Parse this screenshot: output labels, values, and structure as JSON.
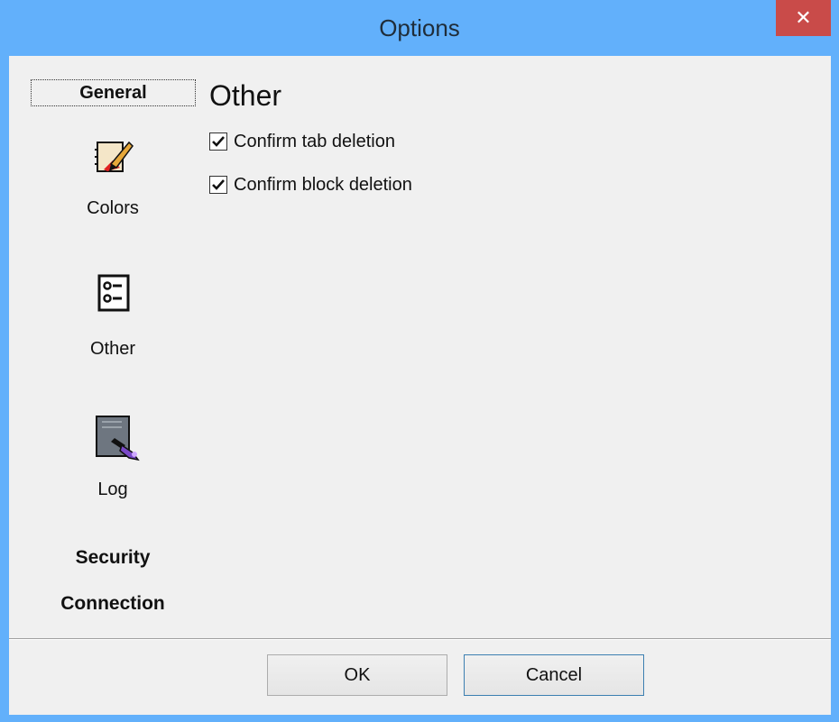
{
  "window": {
    "title": "Options",
    "close_label": "✕"
  },
  "sidebar": {
    "items": [
      {
        "label": "General",
        "icon": "none"
      },
      {
        "label": "Colors",
        "icon": "palette-icon"
      },
      {
        "label": "Other",
        "icon": "list-icon"
      },
      {
        "label": "Log",
        "icon": "log-document-icon"
      },
      {
        "label": "Security",
        "icon": "none"
      },
      {
        "label": "Connection",
        "icon": "none"
      }
    ]
  },
  "content": {
    "section_title": "Other",
    "checkboxes": [
      {
        "label": "Confirm tab deletion",
        "checked": true
      },
      {
        "label": "Confirm block deletion",
        "checked": true
      }
    ]
  },
  "footer": {
    "ok_label": "OK",
    "cancel_label": "Cancel"
  },
  "colors": {
    "titlebar": "#62b0fb",
    "close": "#c94b49",
    "client": "#f0f0f0"
  }
}
